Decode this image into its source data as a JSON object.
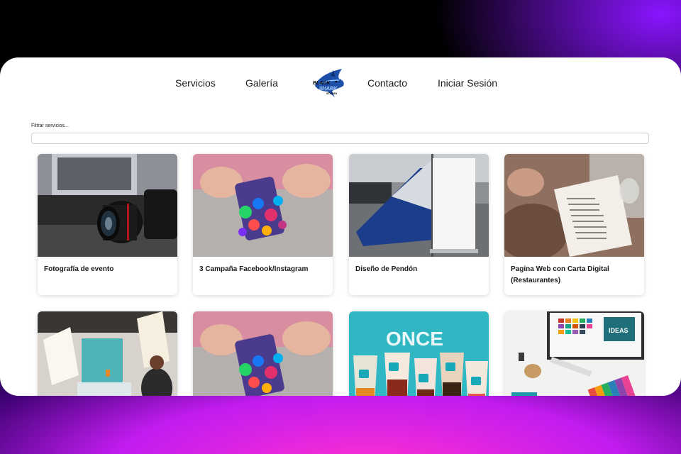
{
  "nav": {
    "links": [
      "Servicios",
      "Galería",
      "Contacto",
      "Iniciar Sesión"
    ],
    "logo_text_1": "BLACK",
    "logo_text_2": "SHARK",
    "logo_text_3": "STUDIO"
  },
  "filter": {
    "label": "Filtrar servicios...",
    "value": ""
  },
  "cards": [
    {
      "title": "Fotografía de evento",
      "image": "camera-lens-photo"
    },
    {
      "title": "3 Campaña Facebook/Instagram",
      "image": "social-media-phone-photo"
    },
    {
      "title": "Diseño de Pendón",
      "image": "roll-up-banner-photo"
    },
    {
      "title": "Pagina Web con Carta Digital (Restaurantes)",
      "image": "restaurant-menu-photo"
    },
    {
      "title": "",
      "image": "photo-studio-photo"
    },
    {
      "title": "",
      "image": "social-media-phone-photo"
    },
    {
      "title": "",
      "image": "bubble-tea-cups-photo"
    },
    {
      "title": "",
      "image": "design-desk-photo"
    }
  ],
  "images": {
    "cups_sign": "ONCE",
    "desk_badge": "IDEAS"
  },
  "colors": {
    "page_bg": "#000000",
    "accent_purple": "#8a14ff",
    "accent_pink": "#ff2fd0",
    "shark_blue": "#1e4fa8"
  }
}
